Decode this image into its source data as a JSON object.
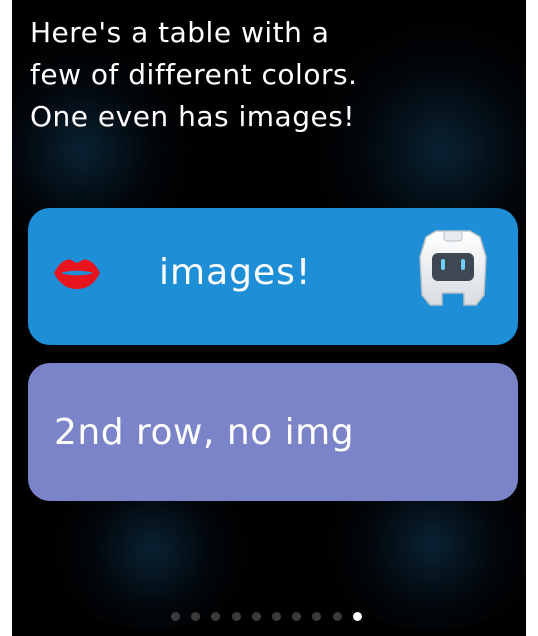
{
  "intro": {
    "text": "Here's a table with a\nfew of different colors.\nOne even has images!"
  },
  "rows": [
    {
      "label": "images!",
      "color": "#1e8ed6",
      "left_icon": "lips-icon",
      "right_icon": "robot-icon"
    },
    {
      "label": "2nd row, no img",
      "color": "#7b83c9"
    }
  ],
  "pager": {
    "total": 10,
    "active_index": 9
  },
  "colors": {
    "background": "#000000",
    "lips": "#e8141e",
    "dot_inactive": "#3a3a3a",
    "dot_active": "#ffffff"
  }
}
